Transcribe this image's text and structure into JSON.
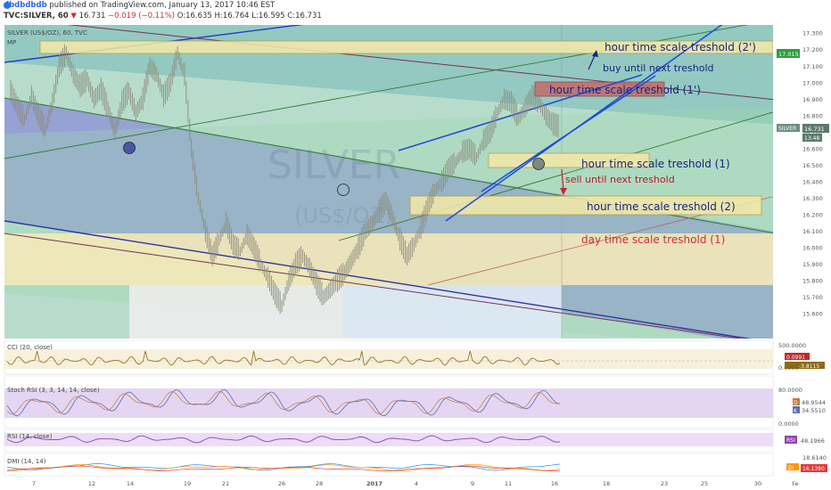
{
  "header": {
    "line1": {
      "author": "dbdbdbdb",
      "published": "published on TradingView.com, January 13, 2017 10:46 EST"
    },
    "line2": {
      "symbol": "TVC:SILVER, 60",
      "last": "16.731",
      "change": "−0.019 (−0.11%)",
      "ohlc": "O:16.635 H:16.764 L:16.595 C:16.731"
    }
  },
  "chart_data": {
    "type": "line",
    "symbol_label": "SILVER (US$/OZ), 60, TVC",
    "study_label": "MP",
    "watermark": {
      "main": "SILVER",
      "sub": "(US$/OZ)"
    },
    "y_ticks": [
      "17.300",
      "17.200",
      "17.100",
      "17.000",
      "16.900",
      "16.800",
      "16.700",
      "16.600",
      "16.500",
      "16.400",
      "16.300",
      "16.200",
      "16.100",
      "16.000",
      "15.900",
      "15.800",
      "15.700",
      "15.600"
    ],
    "ylim": [
      15.55,
      17.32
    ],
    "x_ticks": [
      "7",
      "12",
      "14",
      "19",
      "21",
      "26",
      "28",
      "2017",
      "4",
      "9",
      "11",
      "16",
      "18",
      "23",
      "25",
      "30",
      "Fe"
    ],
    "price_series": [
      16.95,
      16.85,
      16.78,
      16.92,
      16.8,
      16.72,
      16.88,
      17.1,
      17.18,
      17.05,
      16.98,
      17.02,
      16.9,
      16.96,
      16.84,
      16.7,
      16.88,
      16.95,
      16.82,
      16.9,
      17.1,
      17.05,
      16.92,
      17.0,
      17.18,
      17.05,
      16.6,
      16.3,
      16.1,
      15.95,
      16.05,
      16.15,
      16.02,
      15.98,
      16.08,
      16.0,
      15.9,
      15.82,
      15.72,
      15.65,
      15.8,
      15.9,
      15.95,
      15.88,
      15.78,
      15.7,
      15.75,
      15.8,
      15.85,
      15.92,
      16.0,
      16.1,
      16.15,
      16.22,
      16.28,
      16.18,
      16.05,
      15.95,
      16.02,
      16.12,
      16.25,
      16.35,
      16.4,
      16.48,
      16.52,
      16.58,
      16.6,
      16.55,
      16.65,
      16.7,
      16.82,
      16.9,
      16.88,
      16.78,
      16.85,
      16.92,
      16.88,
      16.8,
      16.75,
      16.73
    ],
    "last": {
      "value": "16.731",
      "label": "SILVER",
      "sub": "13:48"
    },
    "marker": {
      "value": "17.015"
    },
    "annotations": [
      {
        "text": "hour time scale treshold (2')",
        "color": "#1a237e"
      },
      {
        "text": "buy until next treshold",
        "color": "#1a237e"
      },
      {
        "text": "hour time scale treshold (1')",
        "color": "#1a237e"
      },
      {
        "text": "hour time scale treshold (1)",
        "color": "#1a237e"
      },
      {
        "text": "sell until next treshold",
        "color": "#b71c1c"
      },
      {
        "text": "hour time scale treshold (2)",
        "color": "#1a237e"
      },
      {
        "text": "day time scale treshold (1)",
        "color": "#d32f2f"
      }
    ],
    "indicators": [
      {
        "name": "CCI (20, close)",
        "values": [
          "0.0991",
          "-3.8115"
        ],
        "ticks": [
          "500.0000",
          "0.0000"
        ]
      },
      {
        "name": "Stoch RSI (3, 3, 14, 14, close)",
        "values": [
          "D",
          "48.9544",
          "K",
          "34.5510"
        ],
        "ticks": [
          "80.0000",
          "0.0000"
        ]
      },
      {
        "name": "RSI (14, close)",
        "values": [
          "RSI",
          "48.1966"
        ],
        "ticks": []
      },
      {
        "name": "DMI (14, 14)",
        "values": [
          "18.6140",
          "DI",
          "16.1390"
        ],
        "ticks": []
      }
    ],
    "colors": {
      "price": "#888888",
      "blue_channel": "#2d46c8",
      "box": "#f5e9a8",
      "red_box": "#c26a6a",
      "cci": "#8b6914",
      "stoch": "#7a5aa8",
      "rsi": "#8e44ad"
    }
  }
}
